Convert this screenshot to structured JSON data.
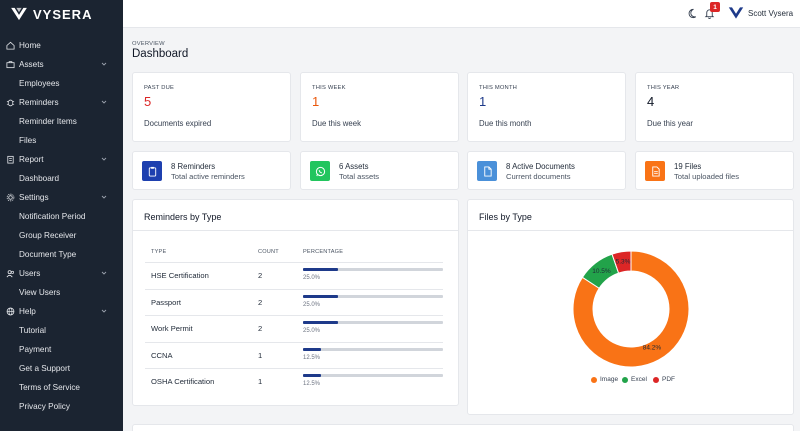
{
  "app": {
    "brand": "VYSERA"
  },
  "sidebar": {
    "items": [
      {
        "label": "Home",
        "level": "top",
        "icon": "home-icon",
        "chevron": false
      },
      {
        "label": "Assets",
        "level": "top",
        "icon": "briefcase-icon",
        "chevron": true
      },
      {
        "label": "Employees",
        "level": "sub"
      },
      {
        "label": "Reminders",
        "level": "top",
        "icon": "bug-icon",
        "chevron": true
      },
      {
        "label": "Reminder Items",
        "level": "sub"
      },
      {
        "label": "Files",
        "level": "sub"
      },
      {
        "label": "Report",
        "level": "top",
        "icon": "clipboard-icon",
        "chevron": true
      },
      {
        "label": "Dashboard",
        "level": "sub"
      },
      {
        "label": "Settings",
        "level": "top",
        "icon": "gear-icon",
        "chevron": true
      },
      {
        "label": "Notification Period",
        "level": "sub"
      },
      {
        "label": "Group Receiver",
        "level": "sub"
      },
      {
        "label": "Document Type",
        "level": "sub"
      },
      {
        "label": "Users",
        "level": "top",
        "icon": "users-icon",
        "chevron": true
      },
      {
        "label": "View Users",
        "level": "sub"
      },
      {
        "label": "Help",
        "level": "top",
        "icon": "globe-icon",
        "chevron": true
      },
      {
        "label": "Tutorial",
        "level": "sub"
      },
      {
        "label": "Payment",
        "level": "sub"
      },
      {
        "label": "Get a Support",
        "level": "sub"
      },
      {
        "label": "Terms of Service",
        "level": "sub"
      },
      {
        "label": "Privacy Policy",
        "level": "sub"
      }
    ]
  },
  "topbar": {
    "notification_count": "1",
    "user_name": "Scott Vysera"
  },
  "header": {
    "overline": "OVERVIEW",
    "title": "Dashboard"
  },
  "stats": [
    {
      "label": "PAST DUE",
      "value": "5",
      "desc": "Documents expired",
      "color": "#dc2626"
    },
    {
      "label": "THIS WEEK",
      "value": "1",
      "desc": "Due this week",
      "color": "#ea580c"
    },
    {
      "label": "THIS MONTH",
      "value": "1",
      "desc": "Due this month",
      "color": "#1e3a8a"
    },
    {
      "label": "THIS YEAR",
      "value": "4",
      "desc": "Due this year",
      "color": "#111827"
    }
  ],
  "info_cards": [
    {
      "title": "8 Reminders",
      "sub": "Total active reminders",
      "color": "#1e40af",
      "icon": "clipboard-icon"
    },
    {
      "title": "6 Assets",
      "sub": "Total assets",
      "color": "#22c55e",
      "icon": "whatsapp-icon"
    },
    {
      "title": "8 Active Documents",
      "sub": "Current documents",
      "color": "#4a90d9",
      "icon": "document-icon"
    },
    {
      "title": "19 Files",
      "sub": "Total uploaded files",
      "color": "#f97316",
      "icon": "file-text-icon"
    }
  ],
  "reminders_panel": {
    "title": "Reminders by Type",
    "headers": {
      "type": "TYPE",
      "count": "COUNT",
      "percentage": "PERCENTAGE"
    },
    "rows": [
      {
        "type": "HSE Certification",
        "count": "2",
        "percent": 25.0,
        "percent_label": "25.0%"
      },
      {
        "type": "Passport",
        "count": "2",
        "percent": 25.0,
        "percent_label": "25.0%"
      },
      {
        "type": "Work Permit",
        "count": "2",
        "percent": 25.0,
        "percent_label": "25.0%"
      },
      {
        "type": "CCNA",
        "count": "1",
        "percent": 12.5,
        "percent_label": "12.5%"
      },
      {
        "type": "OSHA Certification",
        "count": "1",
        "percent": 12.5,
        "percent_label": "12.5%"
      }
    ]
  },
  "files_panel": {
    "title": "Files by Type"
  },
  "chart_data": {
    "type": "pie",
    "subtype": "donut",
    "categories": [
      "Image",
      "Excel",
      "PDF"
    ],
    "values": [
      84.2,
      10.5,
      5.3
    ],
    "labels": [
      "84.2%",
      "10.5%",
      "5.3%"
    ],
    "colors": [
      "#f97316",
      "#22a34a",
      "#dc2626"
    ],
    "legend_position": "bottom"
  }
}
